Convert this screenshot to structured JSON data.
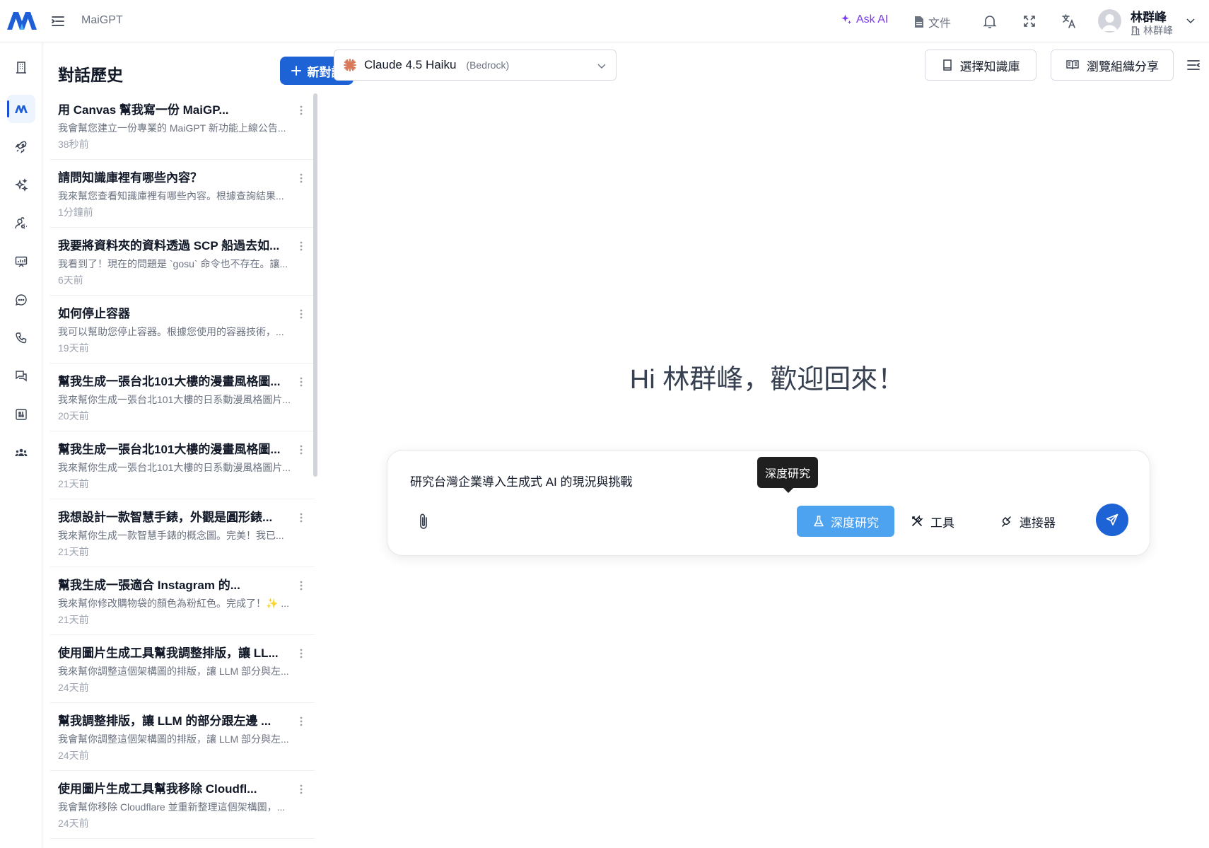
{
  "app": {
    "name": "MaiGPT"
  },
  "topbar": {
    "ask_ai": "Ask AI",
    "docs": "文件",
    "user_name": "林群峰",
    "user_org": "林群峰"
  },
  "rail": {
    "items": [
      "building-icon",
      "maigpt-logo-icon",
      "rocket-icon",
      "sparkles-icon",
      "settings-people-icon",
      "presentation-icon",
      "chat-bubble-icon",
      "phone-icon",
      "chat-dual-icon",
      "grid-icon",
      "team-icon"
    ],
    "active": "maigpt-logo-icon"
  },
  "history": {
    "title": "對話歷史",
    "new_chat_label": "新對話",
    "items": [
      {
        "title": "用 Canvas 幫我寫一份 MaiGP...",
        "snippet": "我會幫您建立一份專業的 MaiGPT 新功能上線公告...",
        "time": "38秒前"
      },
      {
        "title": "請問知識庫裡有哪些內容？",
        "snippet": "我來幫您查看知識庫裡有哪些內容。根據查詢結果...",
        "time": "1分鐘前"
      },
      {
        "title": "我要將資料夾的資料透過 SCP 船過去如...",
        "snippet": "我看到了！現在的問題是 `gosu` 命令也不存在。讓...",
        "time": "6天前"
      },
      {
        "title": "如何停止容器",
        "snippet": "我可以幫助您停止容器。根據您使用的容器技術，...",
        "time": "19天前"
      },
      {
        "title": "幫我生成一張台北101大樓的漫畫風格圖...",
        "snippet": "我來幫你生成一張台北101大樓的日系動漫風格圖片...",
        "time": "20天前"
      },
      {
        "title": "幫我生成一張台北101大樓的漫畫風格圖...",
        "snippet": "我來幫你生成一張台北101大樓的日系動漫風格圖片...",
        "time": "21天前"
      },
      {
        "title": "我想設計一款智慧手錶，外觀是圓形錶...",
        "snippet": "我來幫你生成一款智慧手錶的概念圖。完美！我已...",
        "time": "21天前"
      },
      {
        "title": "幫我生成一張適合 Instagram 的...",
        "snippet": "我來幫你修改購物袋的顏色為粉紅色。完成了！✨ ...",
        "time": "21天前"
      },
      {
        "title": "使用圖片生成工具幫我調整排版，讓 LL...",
        "snippet": "我來幫你調整這個架構圖的排版，讓 LLM 部分與左...",
        "time": "24天前"
      },
      {
        "title": "幫我調整排版，讓 LLM 的部分跟左邊 ...",
        "snippet": "我會幫你調整這個架構圖的排版，讓 LLM 部分與左...",
        "time": "24天前"
      },
      {
        "title": "使用圖片生成工具幫我移除 Cloudfl...",
        "snippet": "我會幫你移除 Cloudflare 並重新整理這個架構圖，...",
        "time": "24天前"
      }
    ]
  },
  "main": {
    "model_name": "Claude 4.5 Haiku",
    "model_provider": "(Bedrock)",
    "select_kb": "選擇知識庫",
    "browse_org": "瀏覽組織分享",
    "welcome": "Hi 林群峰，歡迎回來！",
    "composer": {
      "value": "研究台灣企業導入生成式 AI 的現況與挑戰",
      "deep_research": "深度研究",
      "tools": "工具",
      "connectors": "連接器",
      "tooltip": "深度研究"
    }
  },
  "colors": {
    "primary": "#1d63d6",
    "deep_research_active": "#4da3f0",
    "ask_ai": "#7c3aed"
  }
}
